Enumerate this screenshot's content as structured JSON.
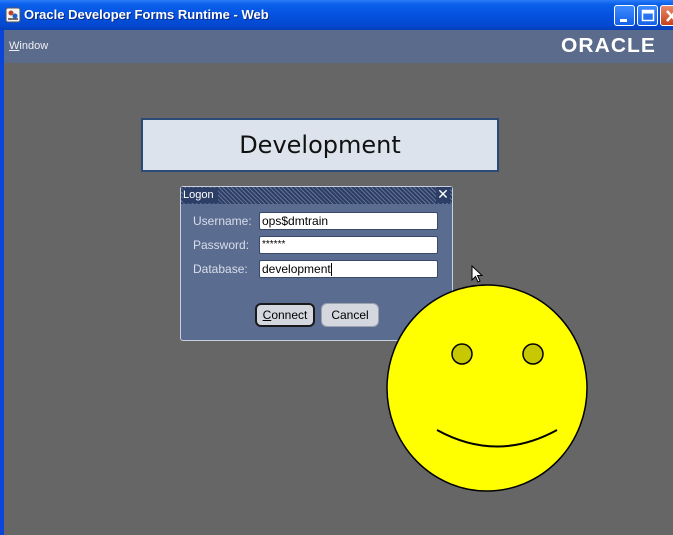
{
  "window": {
    "title": "Oracle Developer Forms Runtime - Web",
    "titlebar_color": "#0552e0"
  },
  "menubar": {
    "items": [
      {
        "label": "Window",
        "mnemonic": "W"
      }
    ],
    "logo": "ORACLE",
    "background": "#5a6b8c"
  },
  "banner": {
    "text": "Development"
  },
  "logon": {
    "title": "Logon",
    "fields": [
      {
        "label": "Username:",
        "value": "ops$dmtrain"
      },
      {
        "label": "Password:",
        "value": "******"
      },
      {
        "label": "Database:",
        "value": "development"
      }
    ],
    "buttons": {
      "connect": "Connect",
      "cancel": "Cancel"
    }
  },
  "overlay": {
    "icon": "smiley-face-icon",
    "fill": "#ffff00"
  }
}
